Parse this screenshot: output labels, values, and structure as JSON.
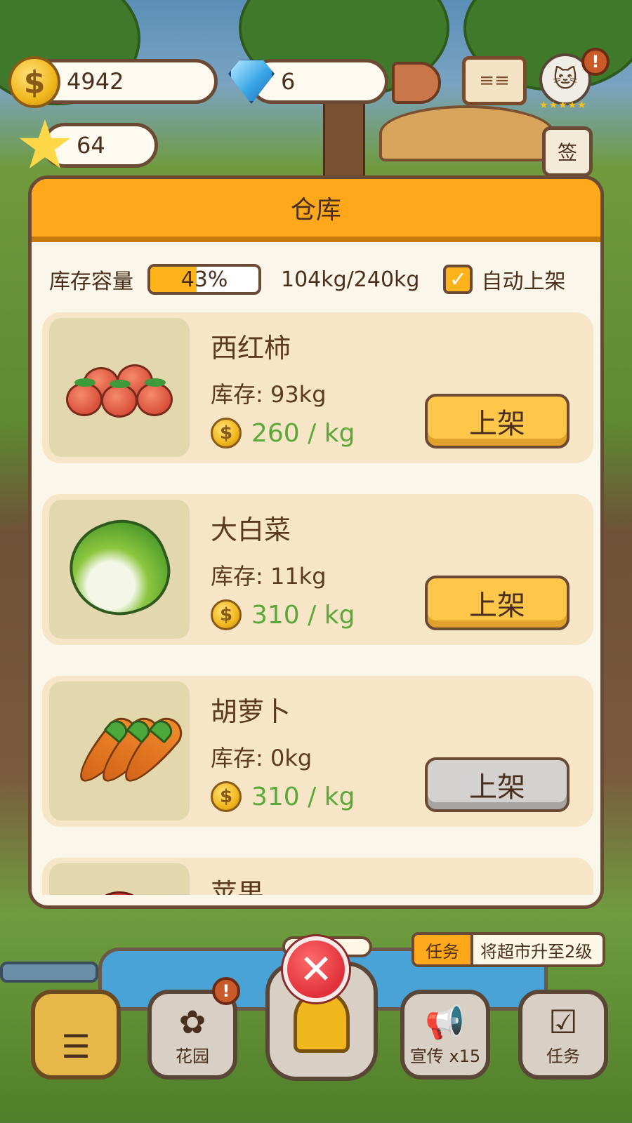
{
  "hud": {
    "coins": "4942",
    "gems": "6",
    "stars": "64",
    "sign_label": "签",
    "cat_rating": "★★★★★"
  },
  "warehouse": {
    "title": "仓库",
    "capacity_label": "库存容量",
    "capacity_fraction": 0.43,
    "capacity_percent": "43%",
    "capacity_weight": "104kg/240kg",
    "auto_list_label": "自动上架",
    "auto_list_checked": true,
    "items": [
      {
        "name": "西红柿",
        "stock": "库存: 93kg",
        "price": "260 / kg",
        "button": "上架",
        "enabled": true,
        "icon": "tomato-icon"
      },
      {
        "name": "大白菜",
        "stock": "库存: 11kg",
        "price": "310 / kg",
        "button": "上架",
        "enabled": true,
        "icon": "cabbage-icon"
      },
      {
        "name": "胡萝卜",
        "stock": "库存: 0kg",
        "price": "310 / kg",
        "button": "上架",
        "enabled": false,
        "icon": "carrot-icon"
      },
      {
        "name": "苹果",
        "icon": "apple-icon"
      }
    ]
  },
  "task": {
    "tag": "任务",
    "text": "将超市升至2级"
  },
  "bottom_nav": {
    "garden": "花园",
    "promote": "宣传 x15",
    "tasks": "任务"
  },
  "colors": {
    "accent_orange": "#ffa81a",
    "price_green": "#5ba83a",
    "button_yellow": "#ffc74a",
    "button_disabled": "#d4d2d0"
  }
}
